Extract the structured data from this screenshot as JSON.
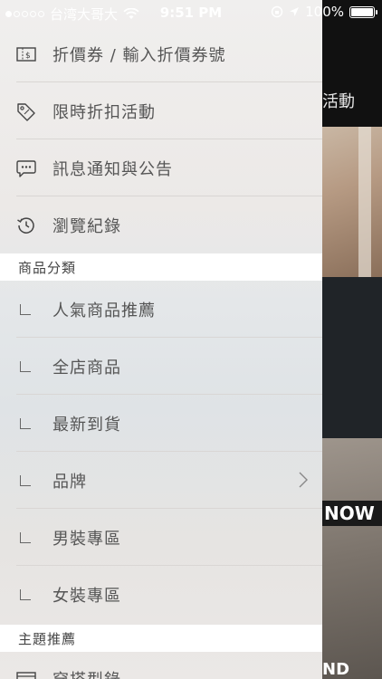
{
  "status_bar": {
    "carrier": "台湾大哥大",
    "time": "9:51 PM",
    "battery": "100%",
    "battery_level": 1.0
  },
  "menu": {
    "items": [
      {
        "label": "折價券 / 輸入折價券號",
        "icon": "coupon-icon"
      },
      {
        "label": "限時折扣活動",
        "icon": "tag-icon"
      },
      {
        "label": "訊息通知與公告",
        "icon": "message-icon"
      },
      {
        "label": "瀏覽紀錄",
        "icon": "history-icon"
      }
    ],
    "section_categories": "商品分類",
    "categories": [
      {
        "label": "人氣商品推薦"
      },
      {
        "label": "全店商品"
      },
      {
        "label": "最新到貨"
      },
      {
        "label": "品牌"
      },
      {
        "label": "男裝專區"
      },
      {
        "label": "女裝專區"
      }
    ],
    "section_featured": "主題推薦",
    "featured_partial": "穿搭型錄"
  },
  "background": {
    "label": "活動",
    "banner_text": "NOW",
    "bottom_text": "ND"
  }
}
